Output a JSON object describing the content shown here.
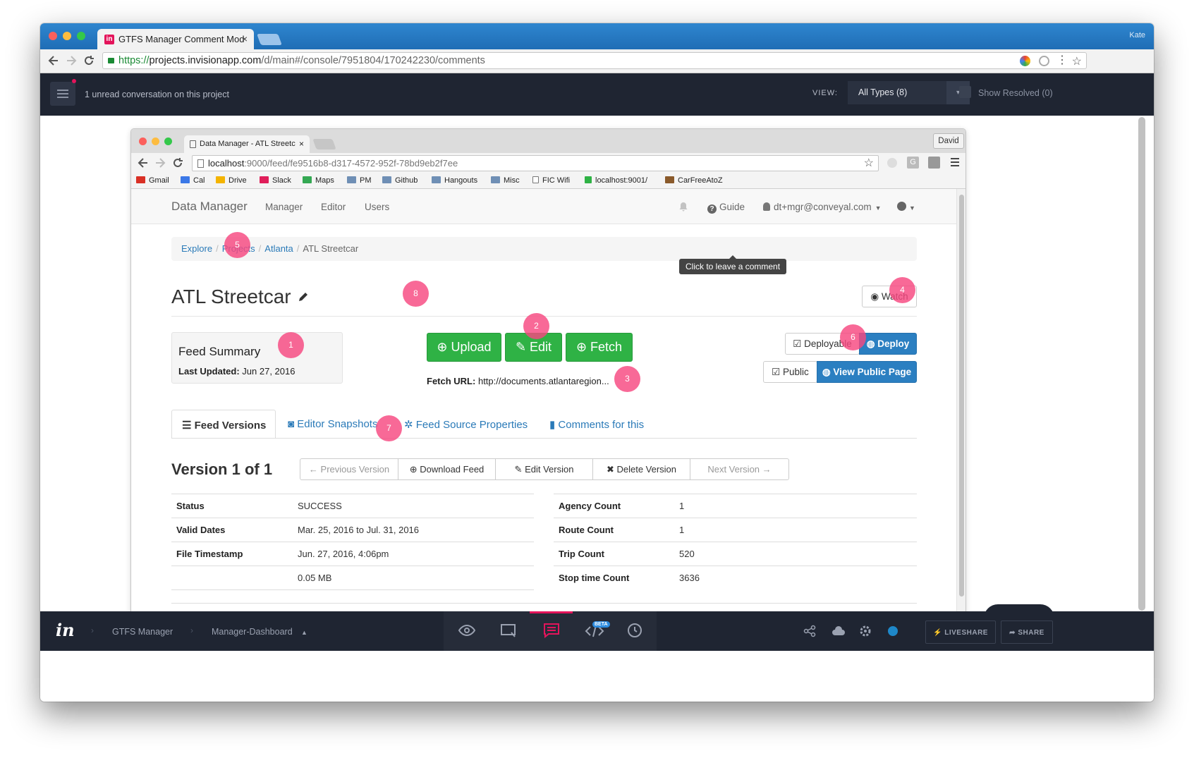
{
  "outer_browser": {
    "tab_title": "GTFS Manager Comment Mod",
    "user": "Kate",
    "url_scheme": "https://",
    "url_host": "projects.invisionapp.com",
    "url_path": "/d/main#/console/7951804/170242230/comments"
  },
  "invision_top": {
    "unread": "1 unread conversation on this project",
    "view_label": "VIEW:",
    "types": "All Types (8)",
    "show_resolved": "Show Resolved (0)"
  },
  "inner_browser": {
    "tab_title": "Data Manager - ATL Streetc",
    "user": "David",
    "url_host": "localhost",
    "url_rest": ":9000/feed/fe9516b8-d317-4572-952f-78bd9eb2f7ee",
    "bookmarks": [
      {
        "label": "Gmail",
        "color": "#d93025"
      },
      {
        "label": "Cal",
        "color": "#3b78e7"
      },
      {
        "label": "Drive",
        "color": "#f4b400"
      },
      {
        "label": "Slack",
        "color": "#e01e5a"
      },
      {
        "label": "Maps",
        "color": "#34a853"
      },
      {
        "label": "PM",
        "color": "#6f8fb5"
      },
      {
        "label": "Github",
        "color": "#6f8fb5"
      },
      {
        "label": "Hangouts",
        "color": "#6f8fb5"
      },
      {
        "label": "Misc",
        "color": "#6f8fb5"
      },
      {
        "label": "FIC Wifi",
        "color": "#ffffff"
      },
      {
        "label": "localhost:9001/",
        "color": "#2fb245"
      },
      {
        "label": "CarFreeAtoZ",
        "color": "#8a5a2b"
      }
    ]
  },
  "app": {
    "brand": "Data Manager",
    "nav": [
      "Manager",
      "Editor",
      "Users"
    ],
    "guide": "Guide",
    "user_email": "dt+mgr@conveyal.com",
    "breadcrumb": [
      "Explore",
      "Projects",
      "Atlanta",
      "ATL Streetcar"
    ],
    "tooltip": "Click to leave a comment",
    "title": "ATL Streetcar",
    "watch": "Watch",
    "summary_title": "Feed Summary",
    "last_updated_label": "Last Updated:",
    "last_updated": "Jun 27, 2016",
    "upload": "Upload",
    "edit": "Edit",
    "fetch": "Fetch",
    "fetch_url_label": "Fetch URL:",
    "fetch_url": "http://documents.atlantaregion...",
    "deployable": "Deployable",
    "deploy": "Deploy",
    "public": "Public",
    "view_public_page": "View Public Page",
    "tabs": [
      "Feed Versions",
      "Editor Snapshots",
      "Feed Source Properties",
      "Comments for this"
    ],
    "version_title": "Version 1 of 1",
    "version_buttons": [
      "Previous Version",
      "Download Feed",
      "Edit Version",
      "Delete Version",
      "Next Version"
    ],
    "left_table": [
      {
        "label": "Status",
        "value": "SUCCESS"
      },
      {
        "label": "Valid Dates",
        "value": "Mar. 25, 2016 to Jul. 31, 2016"
      },
      {
        "label": "File Timestamp",
        "value": "Jun. 27, 2016, 4:06pm"
      },
      {
        "label": "",
        "value": "0.05 MB"
      }
    ],
    "right_table": [
      {
        "label": "Agency Count",
        "value": "1"
      },
      {
        "label": "Route Count",
        "value": "1"
      },
      {
        "label": "Trip Count",
        "value": "520"
      },
      {
        "label": "Stop time Count",
        "value": "3636"
      }
    ]
  },
  "hotspots": [
    "1",
    "2",
    "3",
    "4",
    "5",
    "6",
    "7",
    "8"
  ],
  "invision_bottom": {
    "project": "GTFS Manager",
    "screen": "Manager-Dashboard",
    "beta": "BETA",
    "liveshare": "LIVESHARE",
    "share": "SHARE",
    "accent": "#e4145b"
  }
}
